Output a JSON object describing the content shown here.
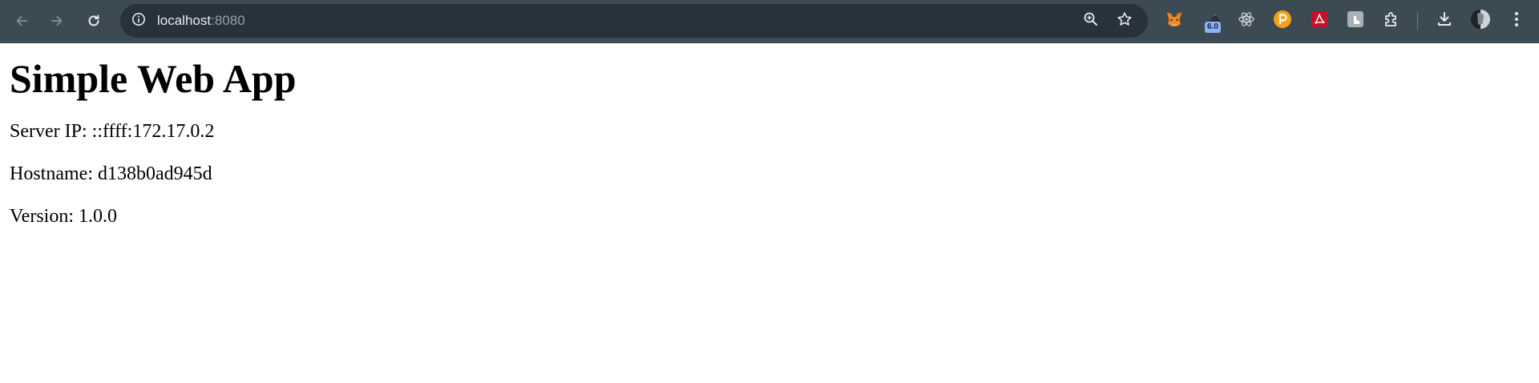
{
  "browser": {
    "url_host": "localhost",
    "url_port": ":8080",
    "extension_badge": "6.0",
    "colors": {
      "toolbar_bg": "#3c4a54",
      "omnibox_bg": "#27323a",
      "icon": "#c4cbd1"
    },
    "icons": {
      "back": "back-arrow-icon",
      "forward": "forward-arrow-icon",
      "reload": "reload-icon",
      "site_info": "info-icon",
      "zoom": "zoom-icon",
      "bookmark": "star-icon",
      "extensions": "puzzle-icon",
      "downloads": "download-icon",
      "menu": "kebab-menu-icon"
    }
  },
  "page": {
    "title": "Simple Web App",
    "server_ip": "Server IP: ::ffff:172.17.0.2",
    "hostname": "Hostname: d138b0ad945d",
    "version": "Version: 1.0.0"
  }
}
